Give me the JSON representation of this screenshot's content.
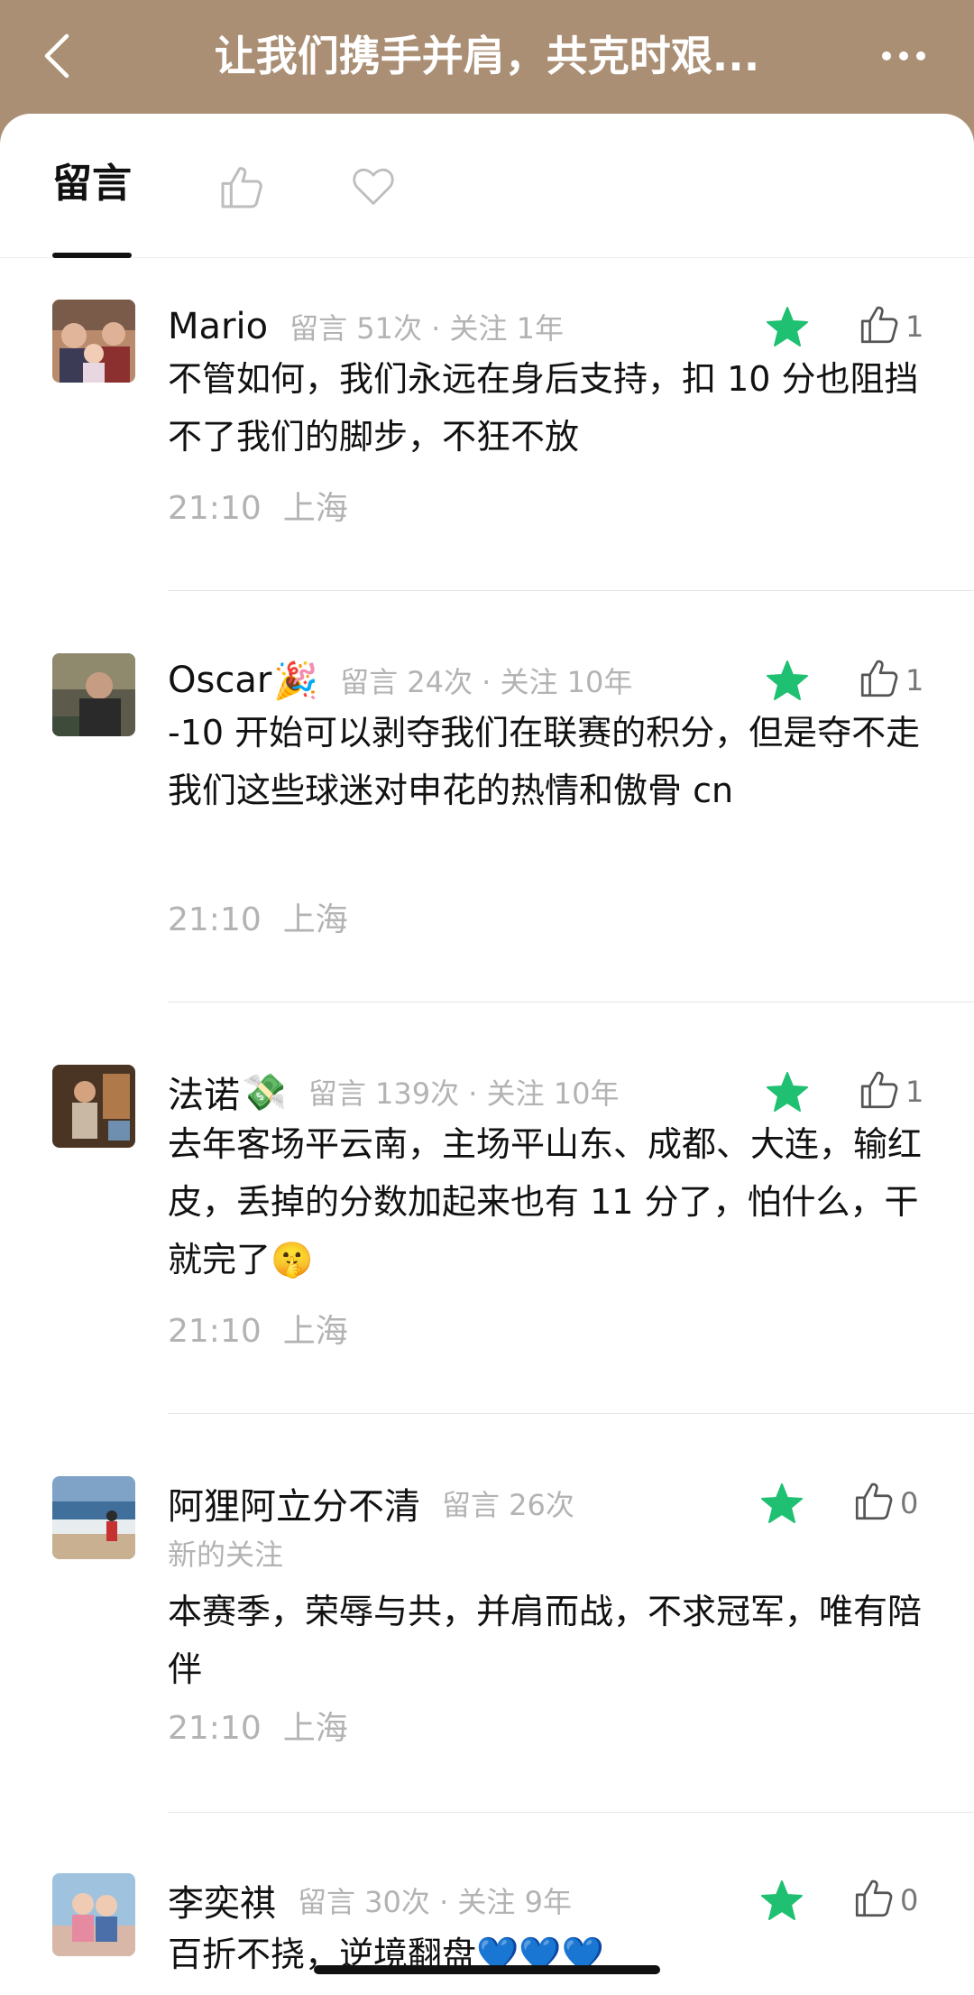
{
  "header": {
    "title": "让我们携手并肩，共克时艰..."
  },
  "tabs": {
    "messages": "留言"
  },
  "comments": [
    {
      "name": "Mario",
      "emoji": "",
      "meta": "留言 51次 · 关注 1年",
      "meta2": "",
      "likes": "1",
      "text": "不管如何，我们永远在身后支持，扣 10 分也阻挡不了我们的脚步，不狂不放",
      "time": "21:10",
      "location": "上海"
    },
    {
      "name": "Oscar",
      "emoji": "🎉",
      "meta": "留言 24次 · 关注 10年",
      "meta2": "",
      "likes": "1",
      "text": "-10 开始可以剥夺我们在联赛的积分，但是夺不走我们这些球迷对申花的热情和傲骨 cn",
      "time": "21:10",
      "location": "上海"
    },
    {
      "name": "法诺",
      "emoji": "💸",
      "meta": "留言 139次 · 关注 10年",
      "meta2": "",
      "likes": "1",
      "text": "去年客场平云南，主场平山东、成都、大连，输红皮，丢掉的分数加起来也有 11 分了，怕什么，干就完了🤫",
      "time": "21:10",
      "location": "上海"
    },
    {
      "name": "阿狸阿立分不清",
      "emoji": "",
      "meta": "留言 26次",
      "meta2": "新的关注",
      "likes": "0",
      "text": "本赛季，荣辱与共，并肩而战，不求冠军，唯有陪伴",
      "time": "21:10",
      "location": "上海"
    },
    {
      "name": "李奕祺",
      "emoji": "",
      "meta": "留言 30次 · 关注 9年",
      "meta2": "",
      "likes": "0",
      "text": "百折不挠，逆境翻盘💙💙💙",
      "time": "",
      "location": ""
    }
  ],
  "colors": {
    "header_bg": "#ab8f75",
    "star_green": "#1fc072",
    "meta_gray": "#b3b3b3"
  },
  "icons": [
    "back-arrow-icon",
    "more-dots-icon",
    "thumbs-up-icon",
    "heart-icon",
    "star-icon"
  ]
}
